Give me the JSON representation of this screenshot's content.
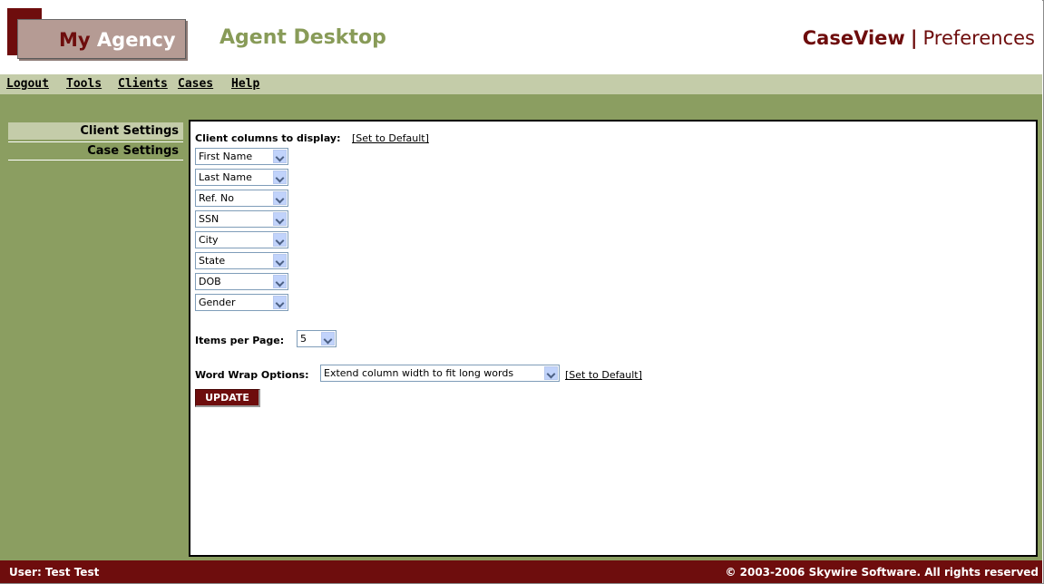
{
  "header": {
    "logo": {
      "word1": "My ",
      "letter": "A",
      "rest": "gency"
    },
    "app_title": "Agent Desktop",
    "caseview": "CaseView",
    "separator": "|",
    "preferences": "Preferences"
  },
  "menu": {
    "items": [
      "Logout",
      "Tools",
      "Clients",
      "Cases",
      "Help"
    ]
  },
  "sidebar": {
    "items": [
      "Client Settings",
      "Case Settings"
    ],
    "active": "Client Settings"
  },
  "settings": {
    "columns_label": "Client columns to display:",
    "set_default_label": "[Set to Default]",
    "columns": [
      "First Name",
      "Last Name",
      "Ref. No",
      "SSN",
      "City",
      "State",
      "DOB",
      "Gender"
    ],
    "items_per_page_label": "Items per Page:",
    "items_per_page_value": "5",
    "word_wrap_label": "Word Wrap Options:",
    "word_wrap_value": "Extend column width to fit long words",
    "word_wrap_default_label": "[Set to Default]",
    "update_label": "UPDATE"
  },
  "footer": {
    "user": "User: Test Test",
    "copyright": "© 2003-2006 Skywire Software. All rights reserved"
  },
  "colors": {
    "brand": "#6e0d0d",
    "accent_green": "#8b9e61",
    "light_green": "#c4cca9",
    "title_green": "#889b58"
  }
}
